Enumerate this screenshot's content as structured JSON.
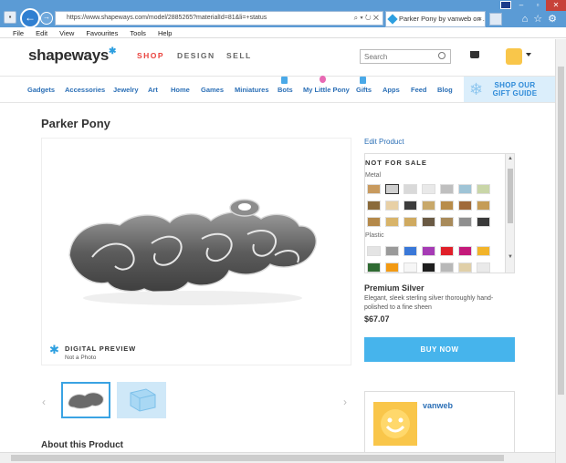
{
  "browser": {
    "url": "https://www.shapeways.com/model/2885265?materialId=81&li=+status",
    "tab_title": "Parker Pony by vanweb on ...",
    "menu": [
      "File",
      "Edit",
      "View",
      "Favourites",
      "Tools",
      "Help"
    ]
  },
  "site": {
    "logo": "shapeways",
    "nav": [
      {
        "label": "SHOP",
        "color": "#e9423d"
      },
      {
        "label": "DESIGN",
        "color": "#666666"
      },
      {
        "label": "SELL",
        "color": "#666666"
      }
    ],
    "search_placeholder": "Search",
    "categories": [
      "Gadgets",
      "Accessories",
      "Jewelry",
      "Art",
      "Home",
      "Games",
      "Miniatures",
      "Bots",
      "My Little Pony",
      "Gifts",
      "Apps",
      "Feed",
      "Blog"
    ],
    "gift_banner": "SHOP OUR GIFT GUIDE"
  },
  "product": {
    "title": "Parker Pony",
    "badge_title": "DIGITAL PREVIEW",
    "badge_sub": "Not a Photo",
    "about": "About this Product"
  },
  "materials": {
    "edit_label": "Edit Product",
    "status": "NOT FOR SALE",
    "group_metal": "Metal",
    "group_plastic": "Plastic",
    "selected_name": "Premium Silver",
    "selected_desc": "Elegant, sleek sterling silver thoroughly hand-polished to a fine sheen",
    "price": "$67.07",
    "buy_label": "BUY NOW"
  },
  "seller": {
    "name": "vanweb"
  }
}
